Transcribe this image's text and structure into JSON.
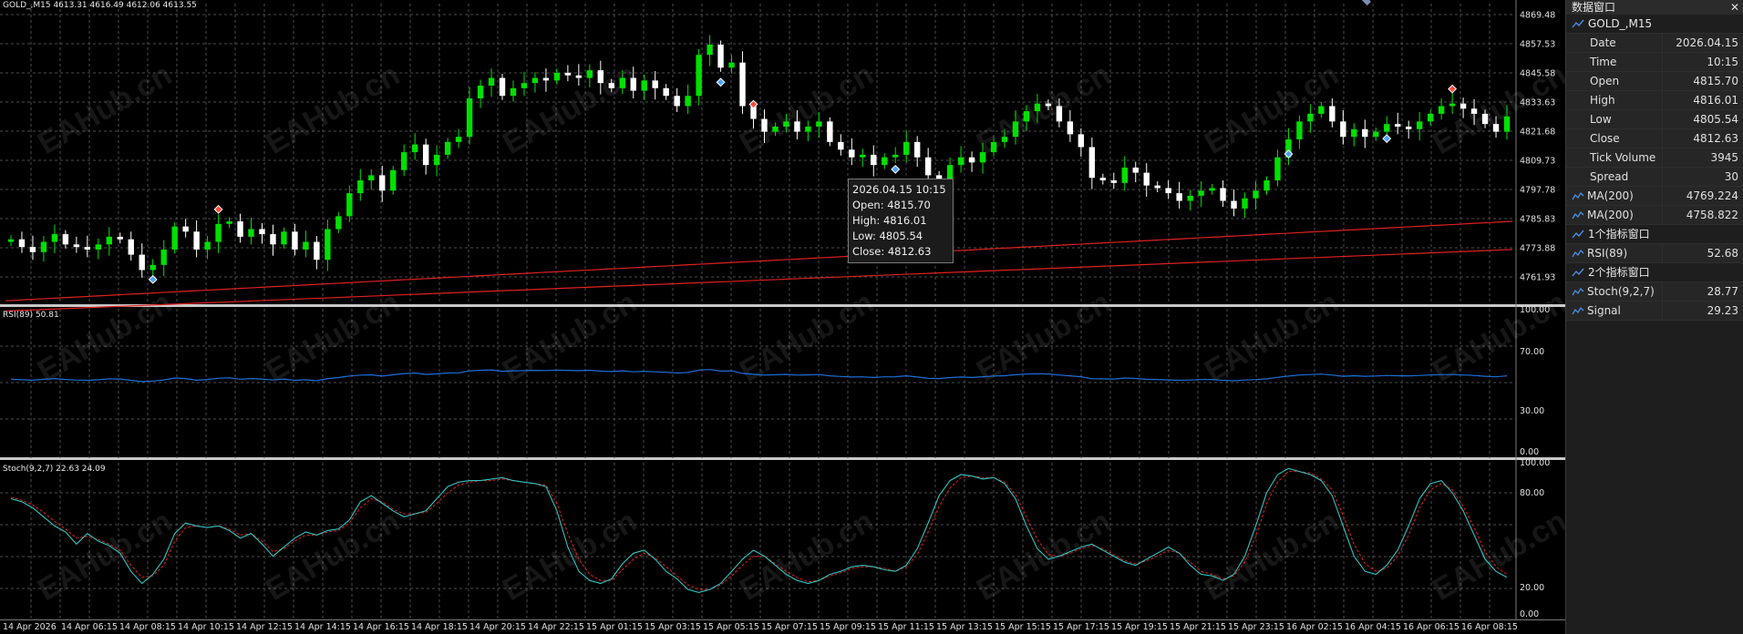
{
  "colors": {
    "background": "#000000",
    "grid": "#4d4d4d",
    "bull_candle": "#00e000",
    "bear_candle": "#ffffff",
    "ma": "#e02020",
    "rsi": "#1e6fd8",
    "stoch_main": "#2ec4c4",
    "stoch_signal": "#e02020",
    "text": "#e0e0e0"
  },
  "main_caption": "GOLD_,M15  4613.31 4616.49 4612.06 4613.55",
  "rsi_caption": "RSI(89) 50.81",
  "stoch_caption": "Stoch(9,2,7) 22.63 24.09",
  "price_axis": [
    "4869.48",
    "4857.53",
    "4845.58",
    "4833.63",
    "4821.68",
    "4809.73",
    "4797.78",
    "4785.83",
    "4773.88",
    "4761.93"
  ],
  "rsi_axis": [
    "100.00",
    "70.00",
    "30.00",
    "0.00"
  ],
  "stoch_axis": [
    "100.00",
    "80.00",
    "20.00",
    "0.00"
  ],
  "time_axis": [
    "14 Apr 2026",
    "14 Apr 06:15",
    "14 Apr 08:15",
    "14 Apr 10:15",
    "14 Apr 12:15",
    "14 Apr 14:15",
    "14 Apr 16:15",
    "14 Apr 18:15",
    "14 Apr 20:15",
    "14 Apr 22:15",
    "15 Apr 01:15",
    "15 Apr 03:15",
    "15 Apr 05:15",
    "15 Apr 07:15",
    "15 Apr 09:15",
    "15 Apr 11:15",
    "15 Apr 13:15",
    "15 Apr 15:15",
    "15 Apr 17:15",
    "15 Apr 19:15",
    "15 Apr 21:15",
    "15 Apr 23:15",
    "16 Apr 02:15",
    "16 Apr 04:15",
    "16 Apr 06:15",
    "16 Apr 08:15"
  ],
  "watermark": "EAHub.cn",
  "tooltip": {
    "datetime": "2026.04.15 10:15",
    "open": "Open: 4815.70",
    "high": "High: 4816.01",
    "low": "Low: 4805.54",
    "close": "Close: 4812.63"
  },
  "data_window": {
    "title": "数据窗口",
    "close_glyph": "✕",
    "symbol": "GOLD_,M15",
    "rows": [
      {
        "label": "Date",
        "value": "2026.04.15"
      },
      {
        "label": "Time",
        "value": "10:15"
      },
      {
        "label": "Open",
        "value": "4815.70"
      },
      {
        "label": "High",
        "value": "4816.01"
      },
      {
        "label": "Low",
        "value": "4805.54"
      },
      {
        "label": "Close",
        "value": "4812.63"
      },
      {
        "label": "Tick Volume",
        "value": "3945"
      },
      {
        "label": "Spread",
        "value": "30"
      }
    ],
    "ma_rows": [
      {
        "label": "MA(200)",
        "value": "4769.224"
      },
      {
        "label": "MA(200)",
        "value": "4758.822"
      }
    ],
    "group1": "1个指标窗口",
    "rsi_row": {
      "label": "RSI(89)",
      "value": "52.68"
    },
    "group2": "2个指标窗口",
    "stoch_rows": [
      {
        "label": "Stoch(9,2,7)",
        "value": "28.77"
      },
      {
        "label": "Signal",
        "value": "29.23"
      }
    ]
  },
  "chart_data": {
    "type": "candlestick",
    "symbol": "GOLD_,M15",
    "price_range": [
      4755,
      4872
    ],
    "price_path": [
      4780,
      4777,
      4775,
      4779,
      4782,
      4778,
      4777,
      4776,
      4778,
      4781,
      4780,
      4774,
      4768,
      4770,
      4776,
      4785,
      4783,
      4776,
      4779,
      4786,
      4787,
      4781,
      4784,
      4782,
      4778,
      4783,
      4776,
      4779,
      4772,
      4784,
      4789,
      4798,
      4803,
      4805,
      4799,
      4807,
      4814,
      4817,
      4809,
      4813,
      4818,
      4820,
      4835,
      4840,
      4843,
      4836,
      4839,
      4841,
      4843,
      4842,
      4845,
      4844,
      4843,
      4846,
      4841,
      4839,
      4843,
      4838,
      4842,
      4839,
      4836,
      4832,
      4836,
      4852,
      4856,
      4847,
      4849,
      4832,
      4827,
      4822,
      4824,
      4826,
      4822,
      4824,
      4826,
      4818,
      4815,
      4812,
      4813,
      4809,
      4812,
      4813,
      4818,
      4812,
      4805,
      4803,
      4809,
      4812,
      4810,
      4814,
      4818,
      4820,
      4826,
      4830,
      4833,
      4832,
      4826,
      4821,
      4816,
      4804,
      4803,
      4802,
      4808,
      4806,
      4801,
      4800,
      4798,
      4795,
      4797,
      4799,
      4800,
      4795,
      4792,
      4796,
      4799,
      4803,
      4812,
      4819,
      4826,
      4829,
      4832,
      4826,
      4820,
      4823,
      4820,
      4822,
      4825,
      4824,
      4823,
      4826,
      4829,
      4832,
      4833,
      4831,
      4829,
      4825,
      4822,
      4828
    ],
    "ma_200_a": {
      "start": 4756,
      "end": 4787
    },
    "ma_200_b": {
      "start": 4752,
      "end": 4776
    },
    "rsi_series": [
      53,
      52.6,
      52.3,
      52.9,
      53.4,
      52.8,
      52.4,
      52.2,
      52.6,
      53.3,
      53.1,
      52.2,
      51.3,
      51.7,
      52.5,
      53.8,
      53.4,
      52.3,
      52.8,
      53.7,
      53.9,
      53,
      53.4,
      53.1,
      52.4,
      53.1,
      52.2,
      52.6,
      51.9,
      53.4,
      54.1,
      55.2,
      55.8,
      56,
      55.1,
      56.1,
      56.9,
      57.3,
      56.3,
      56.7,
      57.3,
      57.4,
      58.8,
      59.2,
      59.4,
      58.5,
      58.8,
      59,
      59.1,
      59,
      59.3,
      59.1,
      58.9,
      59.2,
      58.6,
      58.3,
      58.8,
      58.1,
      58.5,
      58.1,
      57.8,
      57.3,
      57.7,
      59.3,
      59.7,
      58.6,
      58.8,
      57,
      56.4,
      55.8,
      56.1,
      56.3,
      55.8,
      56,
      56.2,
      55.3,
      54.9,
      54.5,
      54.6,
      54.2,
      54.6,
      54.7,
      55.3,
      54.5,
      53.6,
      53.4,
      54.1,
      54.5,
      54.2,
      54.7,
      55.2,
      55.4,
      56.1,
      56.5,
      56.8,
      56.6,
      55.9,
      55.3,
      54.7,
      53.3,
      53.2,
      53.1,
      53.8,
      53.5,
      52.9,
      52.8,
      52.5,
      52.2,
      52.4,
      52.7,
      52.8,
      52.2,
      51.9,
      52.4,
      52.7,
      53.2,
      54.3,
      55.1,
      55.9,
      56.2,
      56.5,
      55.8,
      55,
      55.4,
      55,
      55.2,
      55.6,
      55.4,
      55.3,
      55.6,
      55.9,
      56.2,
      56.2,
      55.9,
      55.6,
      55,
      54.6,
      55.3
    ],
    "stoch_main": [
      78,
      76,
      72,
      66,
      60,
      56,
      48,
      55,
      50,
      47,
      42,
      30,
      22,
      28,
      38,
      55,
      62,
      60,
      59,
      60,
      57,
      52,
      55,
      48,
      40,
      46,
      52,
      56,
      54,
      57,
      58,
      64,
      76,
      80,
      75,
      70,
      66,
      68,
      70,
      78,
      86,
      89,
      90,
      90,
      91,
      92,
      90,
      89,
      88,
      86,
      70,
      46,
      30,
      24,
      22,
      25,
      35,
      42,
      44,
      38,
      30,
      25,
      18,
      16,
      18,
      22,
      30,
      38,
      44,
      40,
      34,
      28,
      24,
      22,
      24,
      28,
      30,
      33,
      34,
      33,
      31,
      30,
      34,
      45,
      62,
      80,
      90,
      94,
      93,
      91,
      92,
      88,
      78,
      60,
      45,
      38,
      40,
      43,
      46,
      48,
      44,
      40,
      36,
      34,
      38,
      42,
      46,
      42,
      34,
      28,
      27,
      24,
      28,
      40,
      60,
      82,
      94,
      98,
      96,
      94,
      90,
      80,
      60,
      40,
      30,
      28,
      34,
      44,
      60,
      78,
      88,
      90,
      82,
      70,
      54,
      38,
      30,
      26
    ],
    "stoch_signal": [
      79,
      77,
      74,
      69,
      63,
      58,
      52,
      53,
      51,
      48,
      44,
      34,
      26,
      27,
      34,
      50,
      59,
      60,
      59,
      60,
      58,
      54,
      55,
      50,
      43,
      45,
      50,
      54,
      54,
      56,
      57,
      62,
      72,
      78,
      76,
      71,
      68,
      68,
      69,
      75,
      82,
      87,
      89,
      90,
      90,
      91,
      90,
      89,
      88,
      87,
      75,
      55,
      38,
      28,
      24,
      24,
      31,
      38,
      42,
      39,
      33,
      27,
      21,
      18,
      18,
      21,
      27,
      34,
      40,
      40,
      35,
      30,
      26,
      23,
      24,
      27,
      29,
      32,
      33,
      33,
      32,
      30,
      33,
      41,
      56,
      73,
      85,
      92,
      93,
      92,
      92,
      89,
      81,
      66,
      51,
      41,
      40,
      42,
      45,
      47,
      45,
      41,
      37,
      35,
      37,
      40,
      44,
      42,
      36,
      30,
      28,
      25,
      27,
      36,
      53,
      75,
      89,
      96,
      96,
      95,
      91,
      84,
      67,
      48,
      35,
      30,
      32,
      40,
      54,
      72,
      84,
      88,
      84,
      73,
      59,
      43,
      33,
      28
    ],
    "signals": [
      {
        "index": 13,
        "type": "buy"
      },
      {
        "index": 19,
        "type": "sell"
      },
      {
        "index": 65,
        "type": "buy"
      },
      {
        "index": 68,
        "type": "sell"
      },
      {
        "index": 81,
        "type": "buy"
      },
      {
        "index": 117,
        "type": "buy"
      },
      {
        "index": 126,
        "type": "buy"
      },
      {
        "index": 132,
        "type": "sell"
      }
    ]
  }
}
